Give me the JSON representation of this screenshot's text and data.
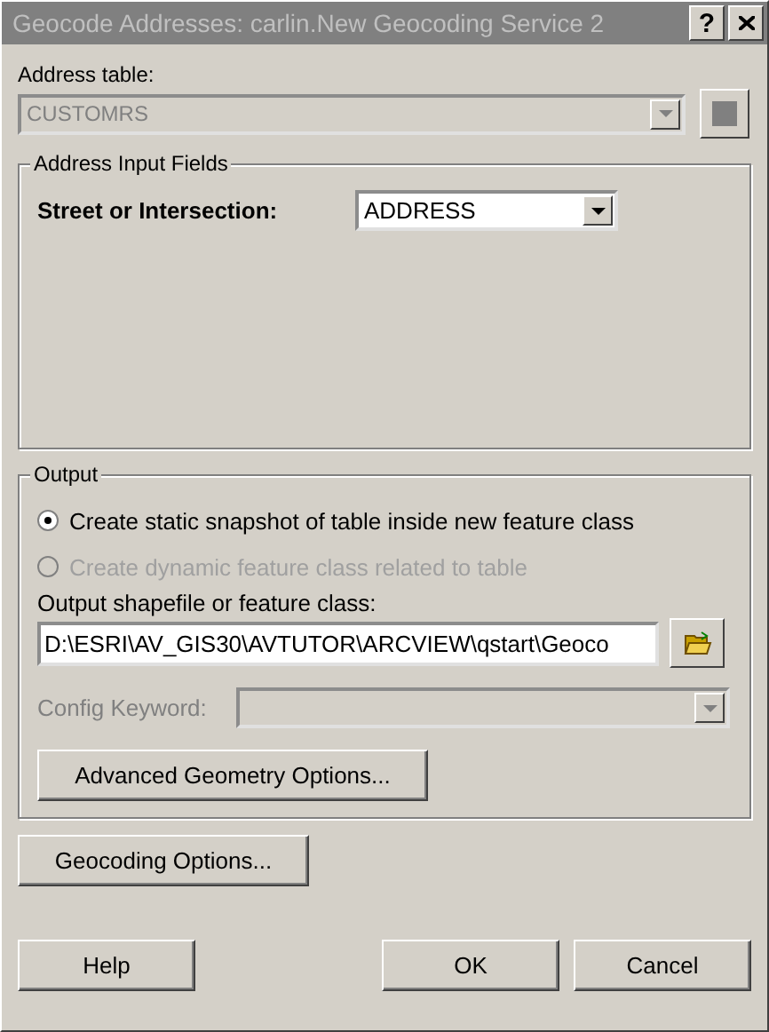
{
  "window": {
    "title": "Geocode Addresses:  carlin.New Geocoding Service 2",
    "active": false,
    "help_button": "?"
  },
  "address_table": {
    "label": "Address table:",
    "value": "CUSTOMRS",
    "disabled": true
  },
  "address_input_fields": {
    "title": "Address Input Fields",
    "fields": [
      {
        "label": "Street or Intersection:",
        "value": "ADDRESS"
      }
    ]
  },
  "output": {
    "title": "Output",
    "options": [
      {
        "label": "Create static snapshot of table inside new feature class",
        "selected": true,
        "disabled": false
      },
      {
        "label": "Create dynamic feature class related to table",
        "selected": false,
        "disabled": true
      }
    ],
    "path_label": "Output shapefile or feature class:",
    "path_value": "D:\\ESRI\\AV_GIS30\\AVTUTOR\\ARCVIEW\\qstart\\Geoco",
    "config_keyword": {
      "label": "Config Keyword:",
      "disabled": true
    },
    "advanced_button": "Advanced Geometry Options..."
  },
  "geocoding_options_button": "Geocoding Options...",
  "buttons": {
    "help": "Help",
    "ok": "OK",
    "cancel": "Cancel"
  }
}
